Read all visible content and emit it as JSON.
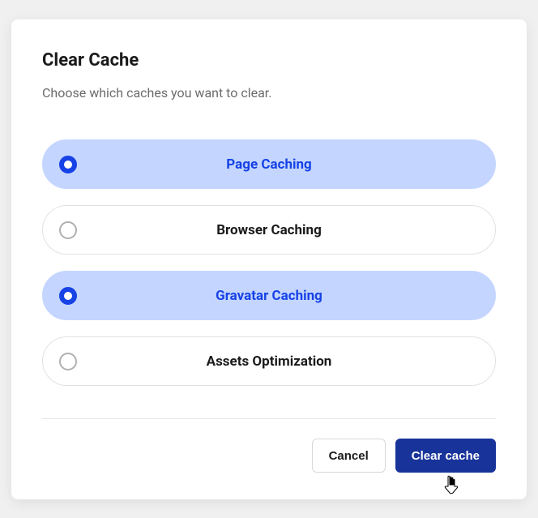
{
  "modal": {
    "title": "Clear Cache",
    "subtitle": "Choose which caches you want to clear.",
    "options": [
      {
        "label": "Page Caching",
        "selected": true
      },
      {
        "label": "Browser Caching",
        "selected": false
      },
      {
        "label": "Gravatar Caching",
        "selected": true
      },
      {
        "label": "Assets Optimization",
        "selected": false
      }
    ],
    "buttons": {
      "cancel": "Cancel",
      "confirm": "Clear cache"
    }
  }
}
